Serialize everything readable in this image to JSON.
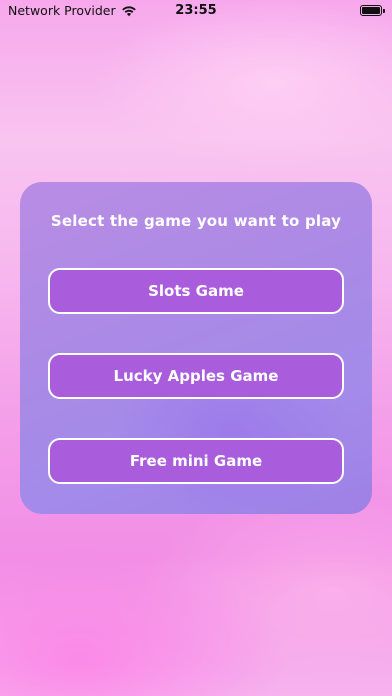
{
  "status_bar": {
    "carrier": "Network Provider",
    "time": "23:55",
    "wifi_icon": "wifi-icon",
    "battery_icon": "battery-full-icon"
  },
  "menu": {
    "title": "Select the game you want to play",
    "buttons": [
      {
        "label": "Slots Game"
      },
      {
        "label": "Lucky Apples Game"
      },
      {
        "label": "Free mini Game"
      }
    ]
  },
  "colors": {
    "card_background": "#a98ae6",
    "button_fill": "#a95ddc",
    "button_border": "#ffffff",
    "text": "#ffffff"
  }
}
